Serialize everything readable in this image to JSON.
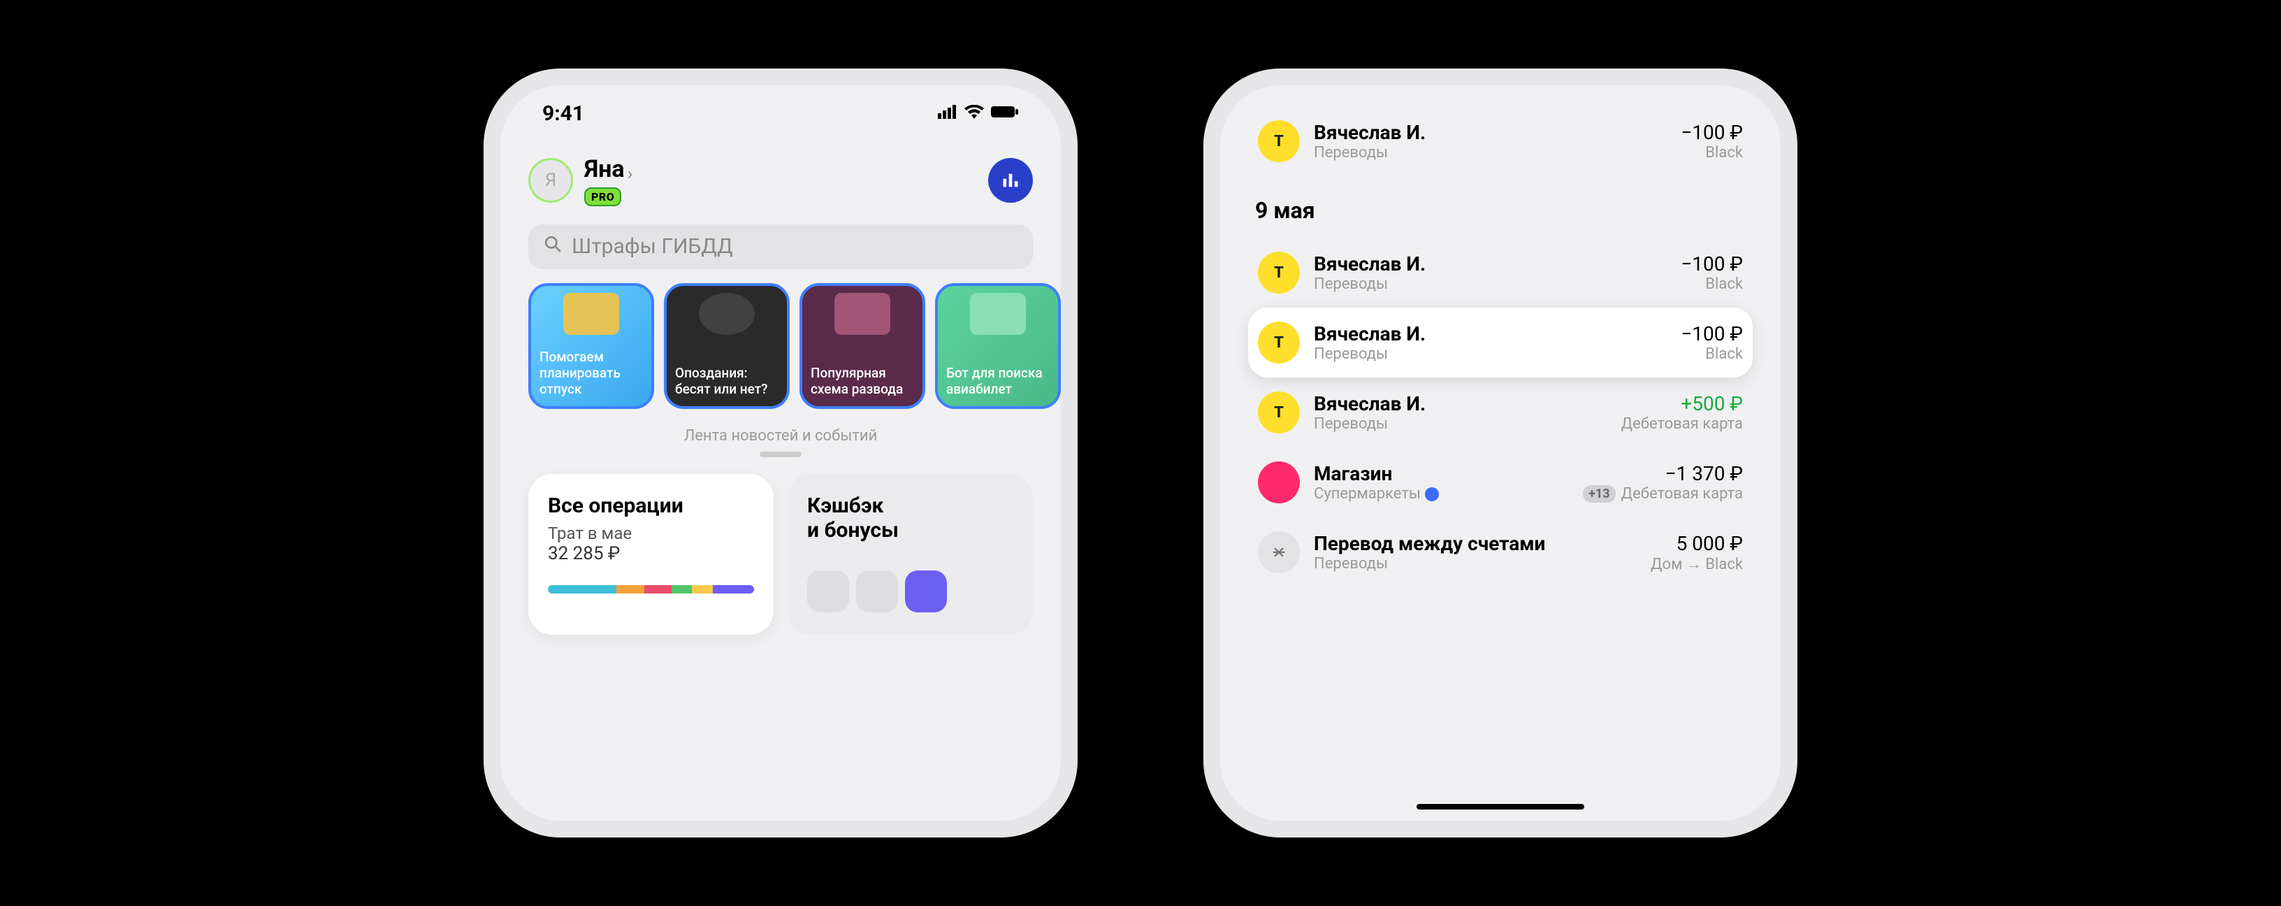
{
  "status": {
    "time": "9:41"
  },
  "header": {
    "user_name": "Яна",
    "avatar_letter": "Я",
    "pro_label": "PRO"
  },
  "search": {
    "placeholder": "Штрафы ГИБДД"
  },
  "stories": [
    {
      "text": "Помогаем планировать отпуск"
    },
    {
      "text": "Опоздания: бесят или нет?"
    },
    {
      "text": "Популярная схема развода"
    },
    {
      "text": "Бот для поиска авиабилет"
    }
  ],
  "feed_label": "Лента новостей и событий",
  "widgets": {
    "ops": {
      "title": "Все операции",
      "sub": "Трат в мае",
      "value": "32 285 ₽"
    },
    "cashback": {
      "title_line1": "Кэшбэк",
      "title_line2": "и бонусы"
    }
  },
  "transactions": {
    "top": {
      "title": "Вячеслав И.",
      "sub": "Переводы",
      "amount": "−100 ₽",
      "card": "Black"
    },
    "date_header": "9 мая",
    "list": [
      {
        "title": "Вячеслав И.",
        "sub": "Переводы",
        "amount": "−100 ₽",
        "card": "Black",
        "icon": "yellow",
        "pos": false,
        "highlight": false
      },
      {
        "title": "Вячеслав И.",
        "sub": "Переводы",
        "amount": "−100 ₽",
        "card": "Black",
        "icon": "yellow",
        "pos": false,
        "highlight": true
      },
      {
        "title": "Вячеслав И.",
        "sub": "Переводы",
        "amount": "+500 ₽",
        "card": "Дебетовая карта",
        "icon": "yellow",
        "pos": true,
        "highlight": false
      },
      {
        "title": "Магазин",
        "sub": "Супермаркеты",
        "amount": "−1 370 ₽",
        "card": "Дебетовая карта",
        "icon": "pink",
        "pos": false,
        "highlight": false,
        "badge": "+13",
        "subDot": true
      },
      {
        "title": "Перевод между счетами",
        "sub": "Переводы",
        "amount": "5 000 ₽",
        "card": "Дом → Black",
        "icon": "gray",
        "pos": false,
        "highlight": false
      }
    ]
  }
}
